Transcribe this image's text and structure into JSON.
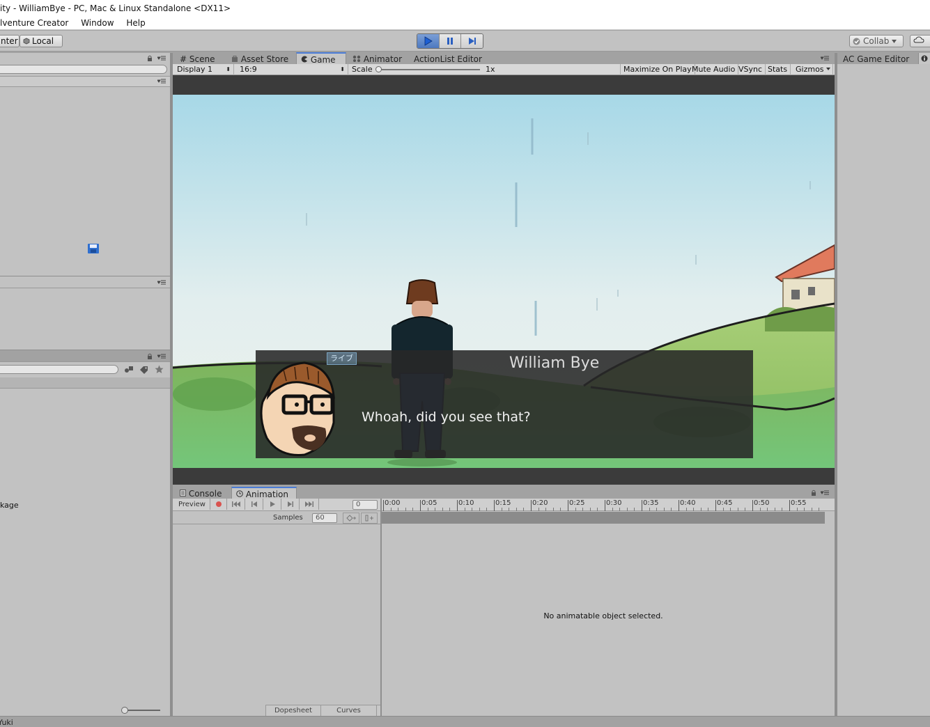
{
  "window": {
    "title": "ity - WilliamBye - PC, Mac & Linux Standalone <DX11>"
  },
  "menu": {
    "items": [
      "lventure Creator",
      "Window",
      "Help"
    ]
  },
  "toolbar": {
    "pivot_label": "nter",
    "local_label": "Local",
    "collab_label": "Collab",
    "play_buttons": [
      "play",
      "pause",
      "step"
    ]
  },
  "center_tabs": [
    {
      "label": "Scene",
      "icon": "grid-icon"
    },
    {
      "label": "Asset Store",
      "icon": "bag-icon"
    },
    {
      "label": "Game",
      "icon": "pacman-icon",
      "active": true
    },
    {
      "label": "Animator",
      "icon": "animator-icon"
    },
    {
      "label": "ActionList Editor",
      "icon": ""
    }
  ],
  "right_tab": {
    "label": "AC Game Editor"
  },
  "game_toolbar": {
    "display": "Display 1",
    "aspect": "16:9",
    "scale_label": "Scale",
    "scale_value": "1x",
    "scale_fraction": 0.0,
    "toggles": [
      "Maximize On Play",
      "Mute Audio",
      "VSync",
      "Stats",
      "Gizmos"
    ]
  },
  "dialogue": {
    "speaker": "William Bye",
    "line": "Whoah, did you see that?",
    "portrait_badge": "ライブ"
  },
  "bottom_tabs": [
    {
      "label": "Console",
      "icon": "console-icon"
    },
    {
      "label": "Animation",
      "icon": "clock-icon",
      "active": true
    }
  ],
  "animation": {
    "preview_label": "Preview",
    "frame_value": "0",
    "samples_label": "Samples",
    "samples_value": "60",
    "timeline_ticks": [
      "0:00",
      "0:05",
      "0:10",
      "0:15",
      "0:20",
      "0:25",
      "0:30",
      "0:35",
      "0:40",
      "0:45",
      "0:50",
      "0:55"
    ],
    "empty_message": "No animatable object selected.",
    "dopesheet_label": "Dopesheet",
    "curves_label": "Curves"
  },
  "left_panel": {
    "package_label": "kage"
  },
  "status_bar": {
    "text": "Yuki"
  }
}
